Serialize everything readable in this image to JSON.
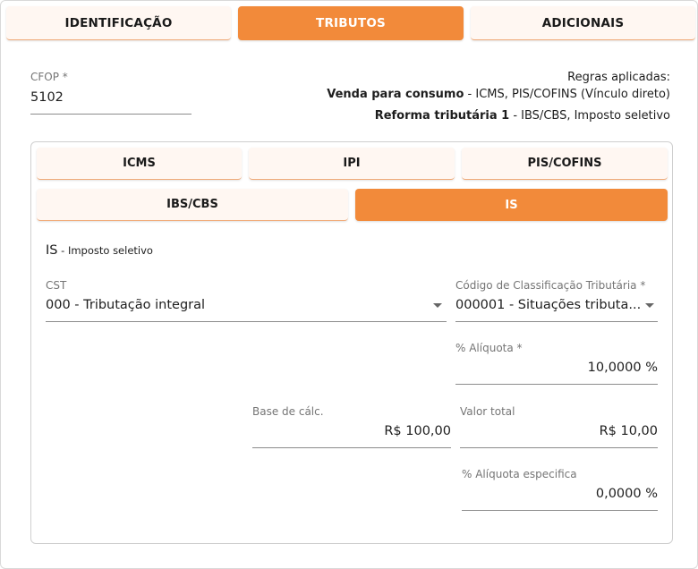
{
  "top_tabs": {
    "identificacao": "IDENTIFICAÇÃO",
    "tributos": "TRIBUTOS",
    "adicionais": "ADICIONAIS"
  },
  "cfop": {
    "label": "CFOP *",
    "value": "5102"
  },
  "rules": {
    "title": "Regras aplicadas:",
    "line1_bold": "Venda para consumo",
    "line1_rest": " - ICMS, PIS/COFINS (Vínculo direto)",
    "line2_bold": "Reforma tributária 1",
    "line2_rest": " - IBS/CBS, Imposto seletivo"
  },
  "sub_tabs": {
    "icms": "ICMS",
    "ipi": "IPI",
    "pis_cofins": "PIS/COFINS",
    "ibs_cbs": "IBS/CBS",
    "is": "IS"
  },
  "section": {
    "code": "IS",
    "desc": " - Imposto seletivo"
  },
  "cst": {
    "label": "CST",
    "value": "000 - Tributação integral"
  },
  "cclass": {
    "label": "Código de Classificação Tributária *",
    "value": "000001 - Situações tributa..."
  },
  "aliquota": {
    "label": "% Alíquota *",
    "value": "10,0000 %"
  },
  "base_calc": {
    "label": "Base de cálc.",
    "value": "R$ 100,00"
  },
  "valor_total": {
    "label": "Valor total",
    "value": "R$ 10,00"
  },
  "aliquota_especifica": {
    "label": "% Alíquota especifica",
    "value": "0,0000 %"
  },
  "colors": {
    "accent": "#f28a3a",
    "tab_bg": "#fff7f2",
    "underline": "#f0aa78"
  }
}
